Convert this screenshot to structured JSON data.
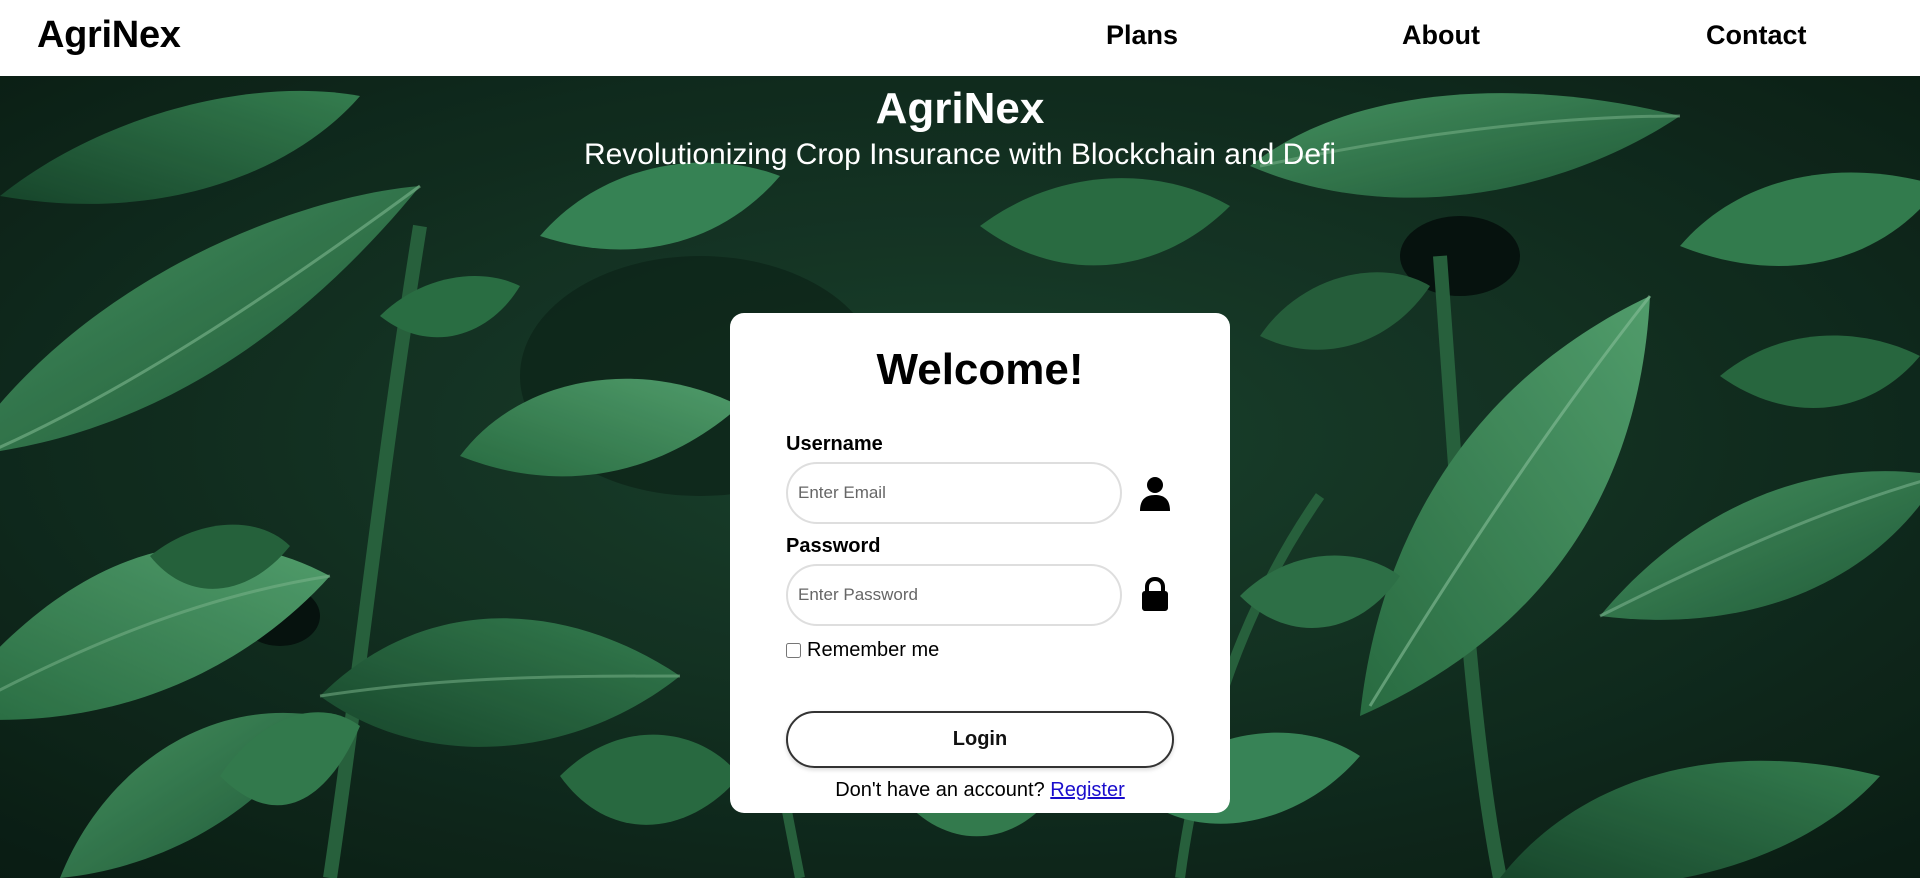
{
  "navbar": {
    "brand": "AgriNex",
    "links": [
      {
        "label": "Plans"
      },
      {
        "label": "About"
      },
      {
        "label": "Contact"
      }
    ]
  },
  "hero": {
    "title": "AgriNex",
    "subtitle": "Revolutionizing Crop Insurance with Blockchain and Defi",
    "background": "green-leaves-photo"
  },
  "login": {
    "title": "Welcome!",
    "username_label": "Username",
    "username_placeholder": "Enter Email",
    "username_icon": "user-icon",
    "password_label": "Password",
    "password_placeholder": "Enter Password",
    "password_icon": "lock-icon",
    "remember_label": "Remember me",
    "remember_checked": false,
    "login_label": "Login",
    "register_prompt": "Don't have an account?",
    "register_link": "Register"
  },
  "colors": {
    "leaf_dark": "#0f2a1c",
    "leaf_mid": "#2c7a4b",
    "leaf_light": "#4aa36a",
    "link": "#1a0dcc"
  }
}
